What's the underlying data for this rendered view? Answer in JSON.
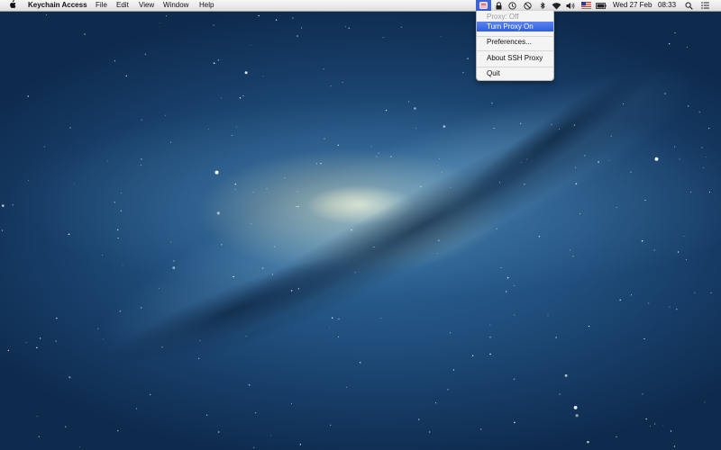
{
  "menubar": {
    "app_name": "Keychain Access",
    "menus": [
      "File",
      "Edit",
      "View",
      "Window",
      "Help"
    ],
    "clock": {
      "date": "Wed 27 Feb",
      "time": "08:33"
    },
    "icons": [
      "apple-icon",
      "ssh-proxy-icon",
      "lock-icon",
      "time-machine-icon",
      "do-not-disturb-icon",
      "bluetooth-icon",
      "wifi-icon",
      "volume-icon",
      "us-flag-icon",
      "battery-icon",
      "spotlight-icon",
      "notification-center-icon"
    ]
  },
  "proxy_menu": {
    "status": "Proxy: Off",
    "items": {
      "turn_on": "Turn Proxy On",
      "preferences": "Preferences...",
      "about": "About SSH Proxy",
      "quit": "Quit"
    }
  },
  "colors": {
    "highlight": "#3a66e4",
    "menubar": "#e8e8e8",
    "wallpaper_deep": "#0e2a4c",
    "galaxy_core": "#fff6d0"
  }
}
